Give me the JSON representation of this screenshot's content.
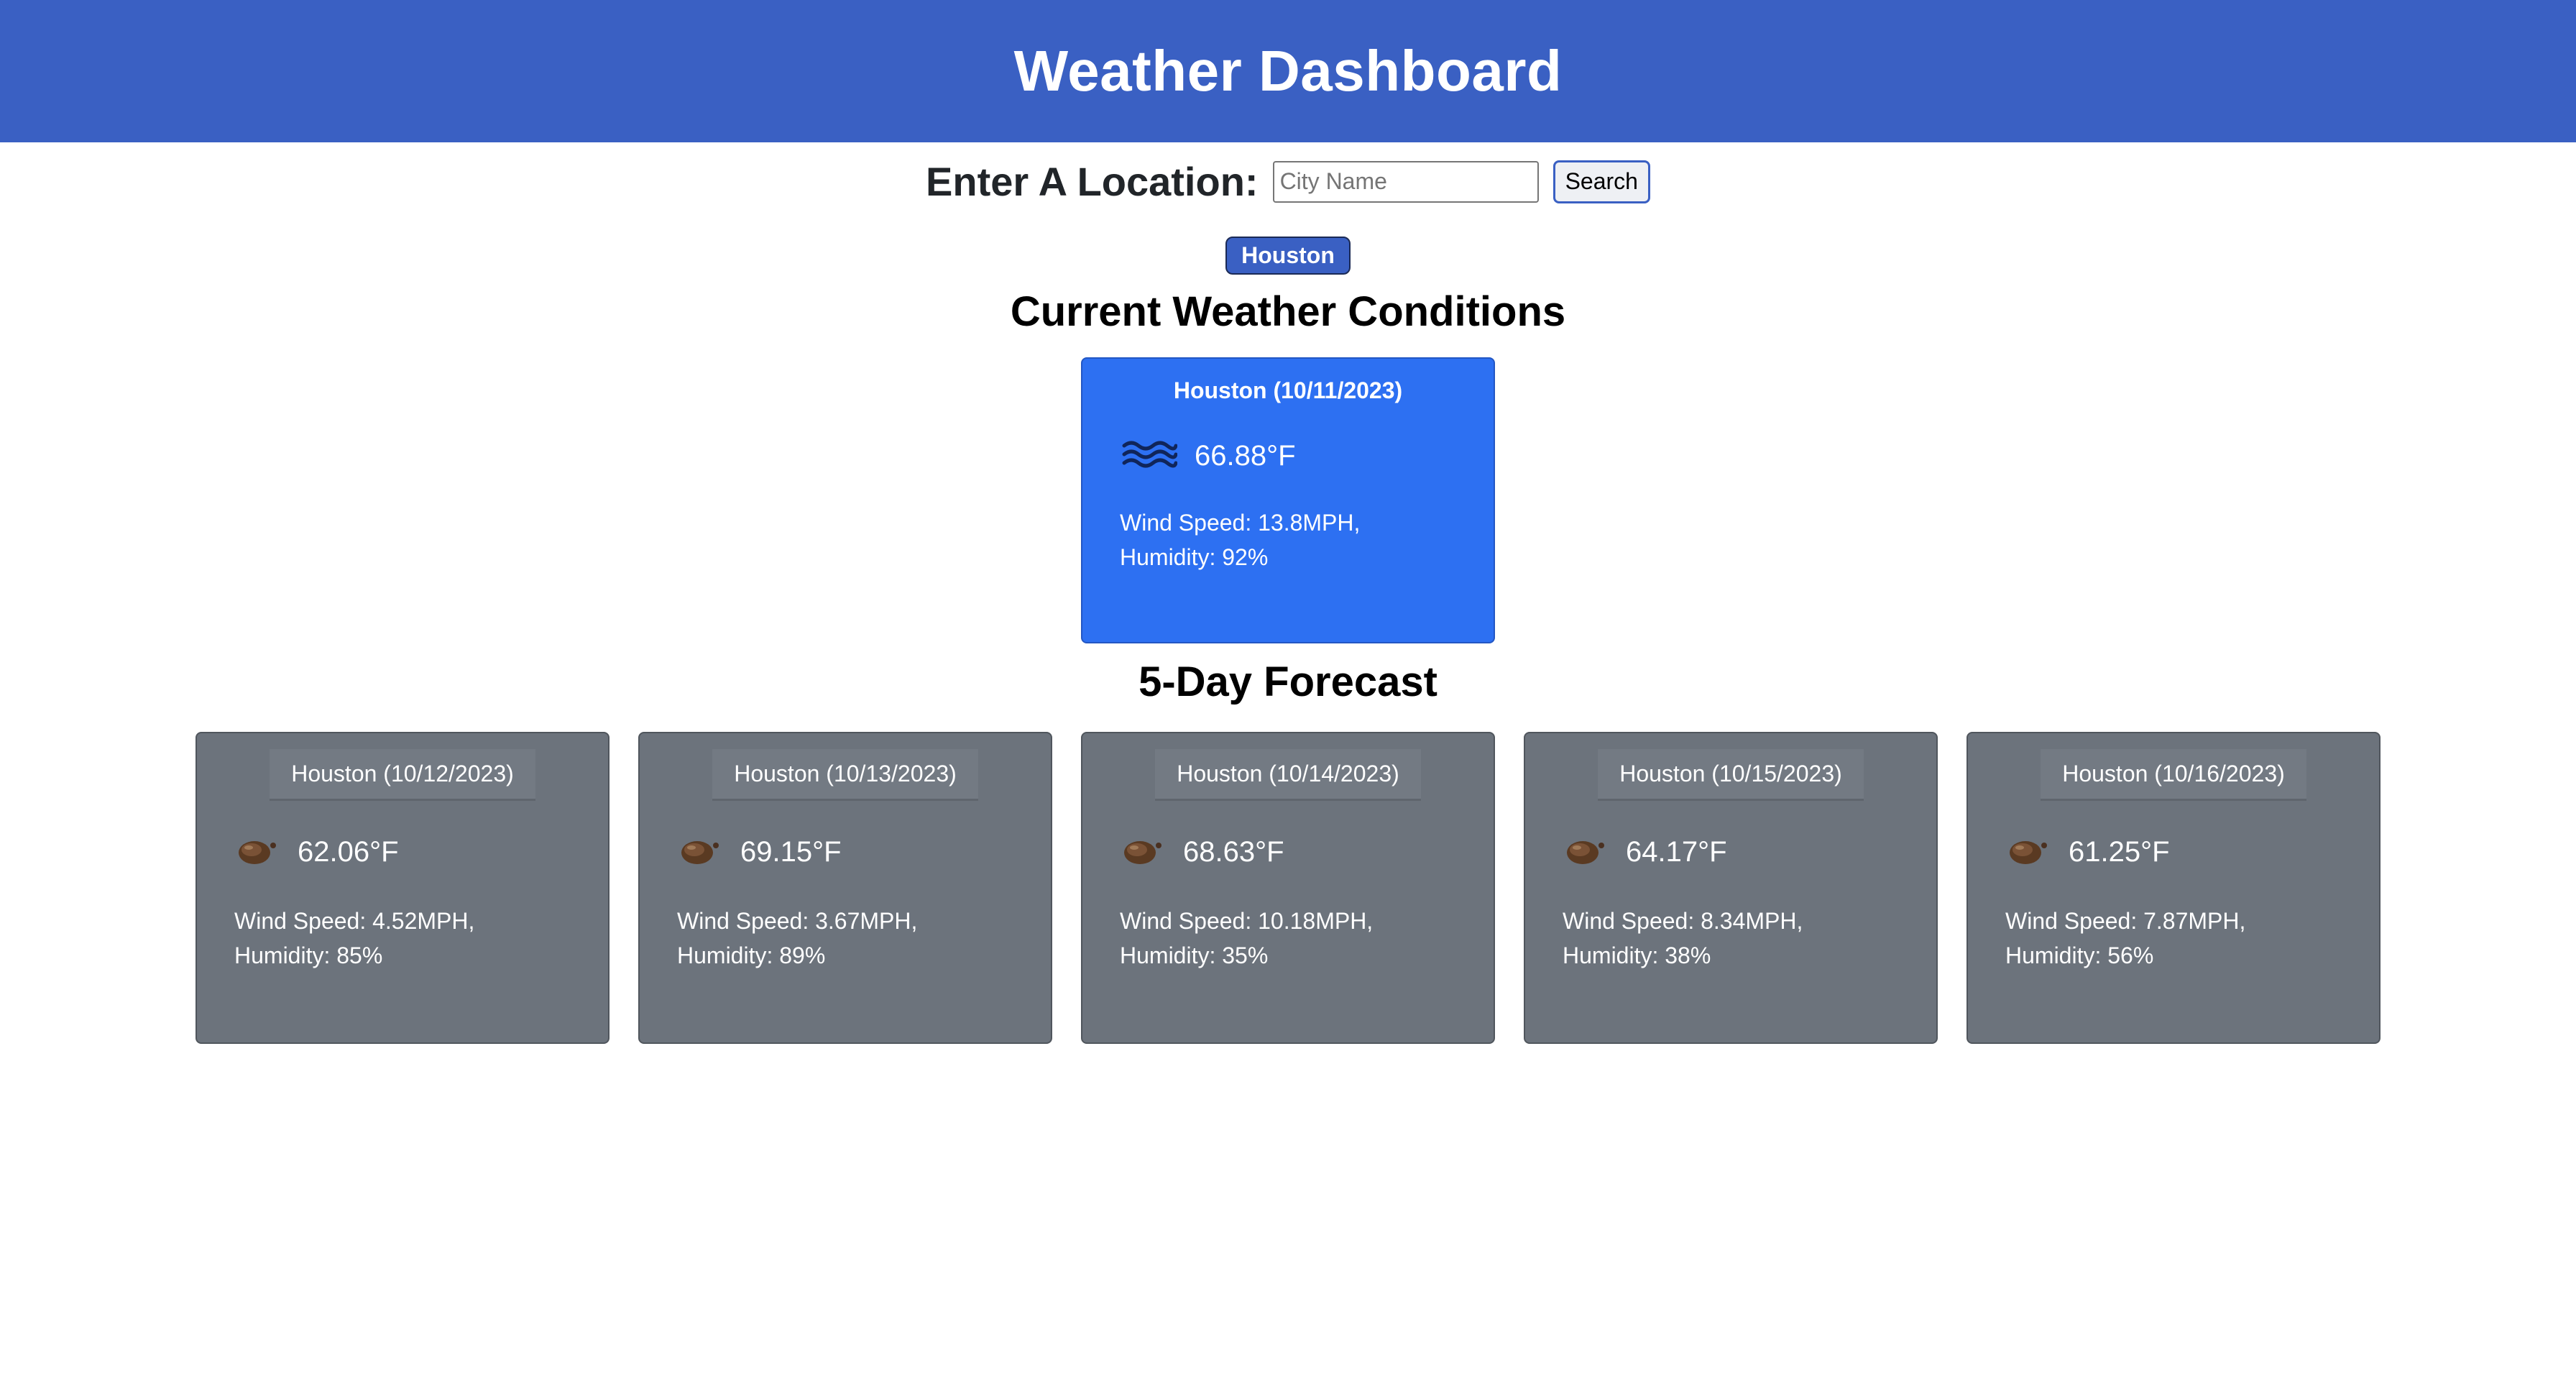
{
  "header": {
    "title": "Weather Dashboard",
    "bg_color": "#3a60c3"
  },
  "search": {
    "label": "Enter A Location:",
    "placeholder": "City Name",
    "value": "",
    "button_label": "Search"
  },
  "history": {
    "items": [
      "Houston"
    ]
  },
  "current": {
    "section_title": "Current Weather Conditions",
    "card_title": "Houston (10/11/2023)",
    "icon": "mist-waves-icon",
    "temp": "66.88°F",
    "wind": "Wind Speed: 13.8MPH,",
    "humidity": "Humidity: 92%",
    "card_color": "#2d70f2"
  },
  "forecast": {
    "section_title": "5-Day Forecast",
    "card_color": "#6c737c",
    "days": [
      {
        "title": "Houston (10/12/2023)",
        "icon": "cloud-icon",
        "temp": "62.06°F",
        "wind": "Wind Speed: 4.52MPH,",
        "humidity": "Humidity: 85%"
      },
      {
        "title": "Houston (10/13/2023)",
        "icon": "cloud-icon",
        "temp": "69.15°F",
        "wind": "Wind Speed: 3.67MPH,",
        "humidity": "Humidity: 89%"
      },
      {
        "title": "Houston (10/14/2023)",
        "icon": "cloud-icon",
        "temp": "68.63°F",
        "wind": "Wind Speed: 10.18MPH,",
        "humidity": "Humidity: 35%"
      },
      {
        "title": "Houston (10/15/2023)",
        "icon": "cloud-icon",
        "temp": "64.17°F",
        "wind": "Wind Speed: 8.34MPH,",
        "humidity": "Humidity: 38%"
      },
      {
        "title": "Houston (10/16/2023)",
        "icon": "cloud-icon",
        "temp": "61.25°F",
        "wind": "Wind Speed: 7.87MPH,",
        "humidity": "Humidity: 56%"
      }
    ]
  }
}
